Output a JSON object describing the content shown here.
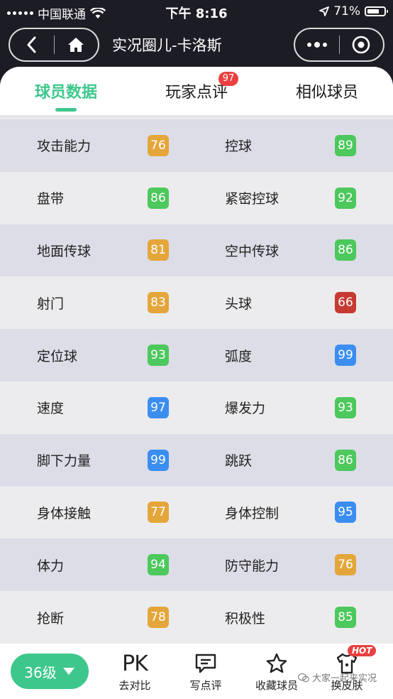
{
  "status_bar": {
    "carrier": "中国联通",
    "time": "下午 8:16",
    "battery": "71%",
    "battery_level": 0.71
  },
  "nav": {
    "title": "实况圈儿-卡洛斯"
  },
  "tabs": [
    {
      "label": "球员数据",
      "active": true
    },
    {
      "label": "玩家点评",
      "badge": "97"
    },
    {
      "label": "相似球员"
    }
  ],
  "stats": [
    {
      "left": {
        "label": "攻击能力",
        "value": "76",
        "color": "#e4a63a"
      },
      "right": {
        "label": "控球",
        "value": "89",
        "color": "#4cc85c"
      }
    },
    {
      "left": {
        "label": "盘带",
        "value": "86",
        "color": "#4cc85c"
      },
      "right": {
        "label": "紧密控球",
        "value": "92",
        "color": "#4cc85c"
      }
    },
    {
      "left": {
        "label": "地面传球",
        "value": "81",
        "color": "#e4a63a"
      },
      "right": {
        "label": "空中传球",
        "value": "86",
        "color": "#4cc85c"
      }
    },
    {
      "left": {
        "label": "射门",
        "value": "83",
        "color": "#e4a63a"
      },
      "right": {
        "label": "头球",
        "value": "66",
        "color": "#c63a32"
      }
    },
    {
      "left": {
        "label": "定位球",
        "value": "93",
        "color": "#4cc85c"
      },
      "right": {
        "label": "弧度",
        "value": "99",
        "color": "#3b8ef0"
      }
    },
    {
      "left": {
        "label": "速度",
        "value": "97",
        "color": "#3b8ef0"
      },
      "right": {
        "label": "爆发力",
        "value": "93",
        "color": "#4cc85c"
      }
    },
    {
      "left": {
        "label": "脚下力量",
        "value": "99",
        "color": "#3b8ef0"
      },
      "right": {
        "label": "跳跃",
        "value": "86",
        "color": "#4cc85c"
      }
    },
    {
      "left": {
        "label": "身体接触",
        "value": "77",
        "color": "#e4a63a"
      },
      "right": {
        "label": "身体控制",
        "value": "95",
        "color": "#3b8ef0"
      }
    },
    {
      "left": {
        "label": "体力",
        "value": "94",
        "color": "#4cc85c"
      },
      "right": {
        "label": "防守能力",
        "value": "76",
        "color": "#e4a63a"
      }
    },
    {
      "left": {
        "label": "抢断",
        "value": "78",
        "color": "#e4a63a"
      },
      "right": {
        "label": "积极性",
        "value": "85",
        "color": "#4cc85c"
      }
    }
  ],
  "bottom_bar": {
    "level": "36级",
    "items": [
      {
        "icon": "PK",
        "label": "去对比",
        "icon_name": "pk-icon"
      },
      {
        "label": "写点评",
        "icon_name": "comment-icon"
      },
      {
        "label": "收藏球员",
        "icon_name": "star-icon"
      },
      {
        "label": "换皮肤",
        "icon_name": "shirt-icon",
        "badge": "HOT"
      }
    ]
  },
  "watermark": "大家一起来实况",
  "colors": {
    "accent": "#3ec78c",
    "badge_red": "#e84040"
  }
}
